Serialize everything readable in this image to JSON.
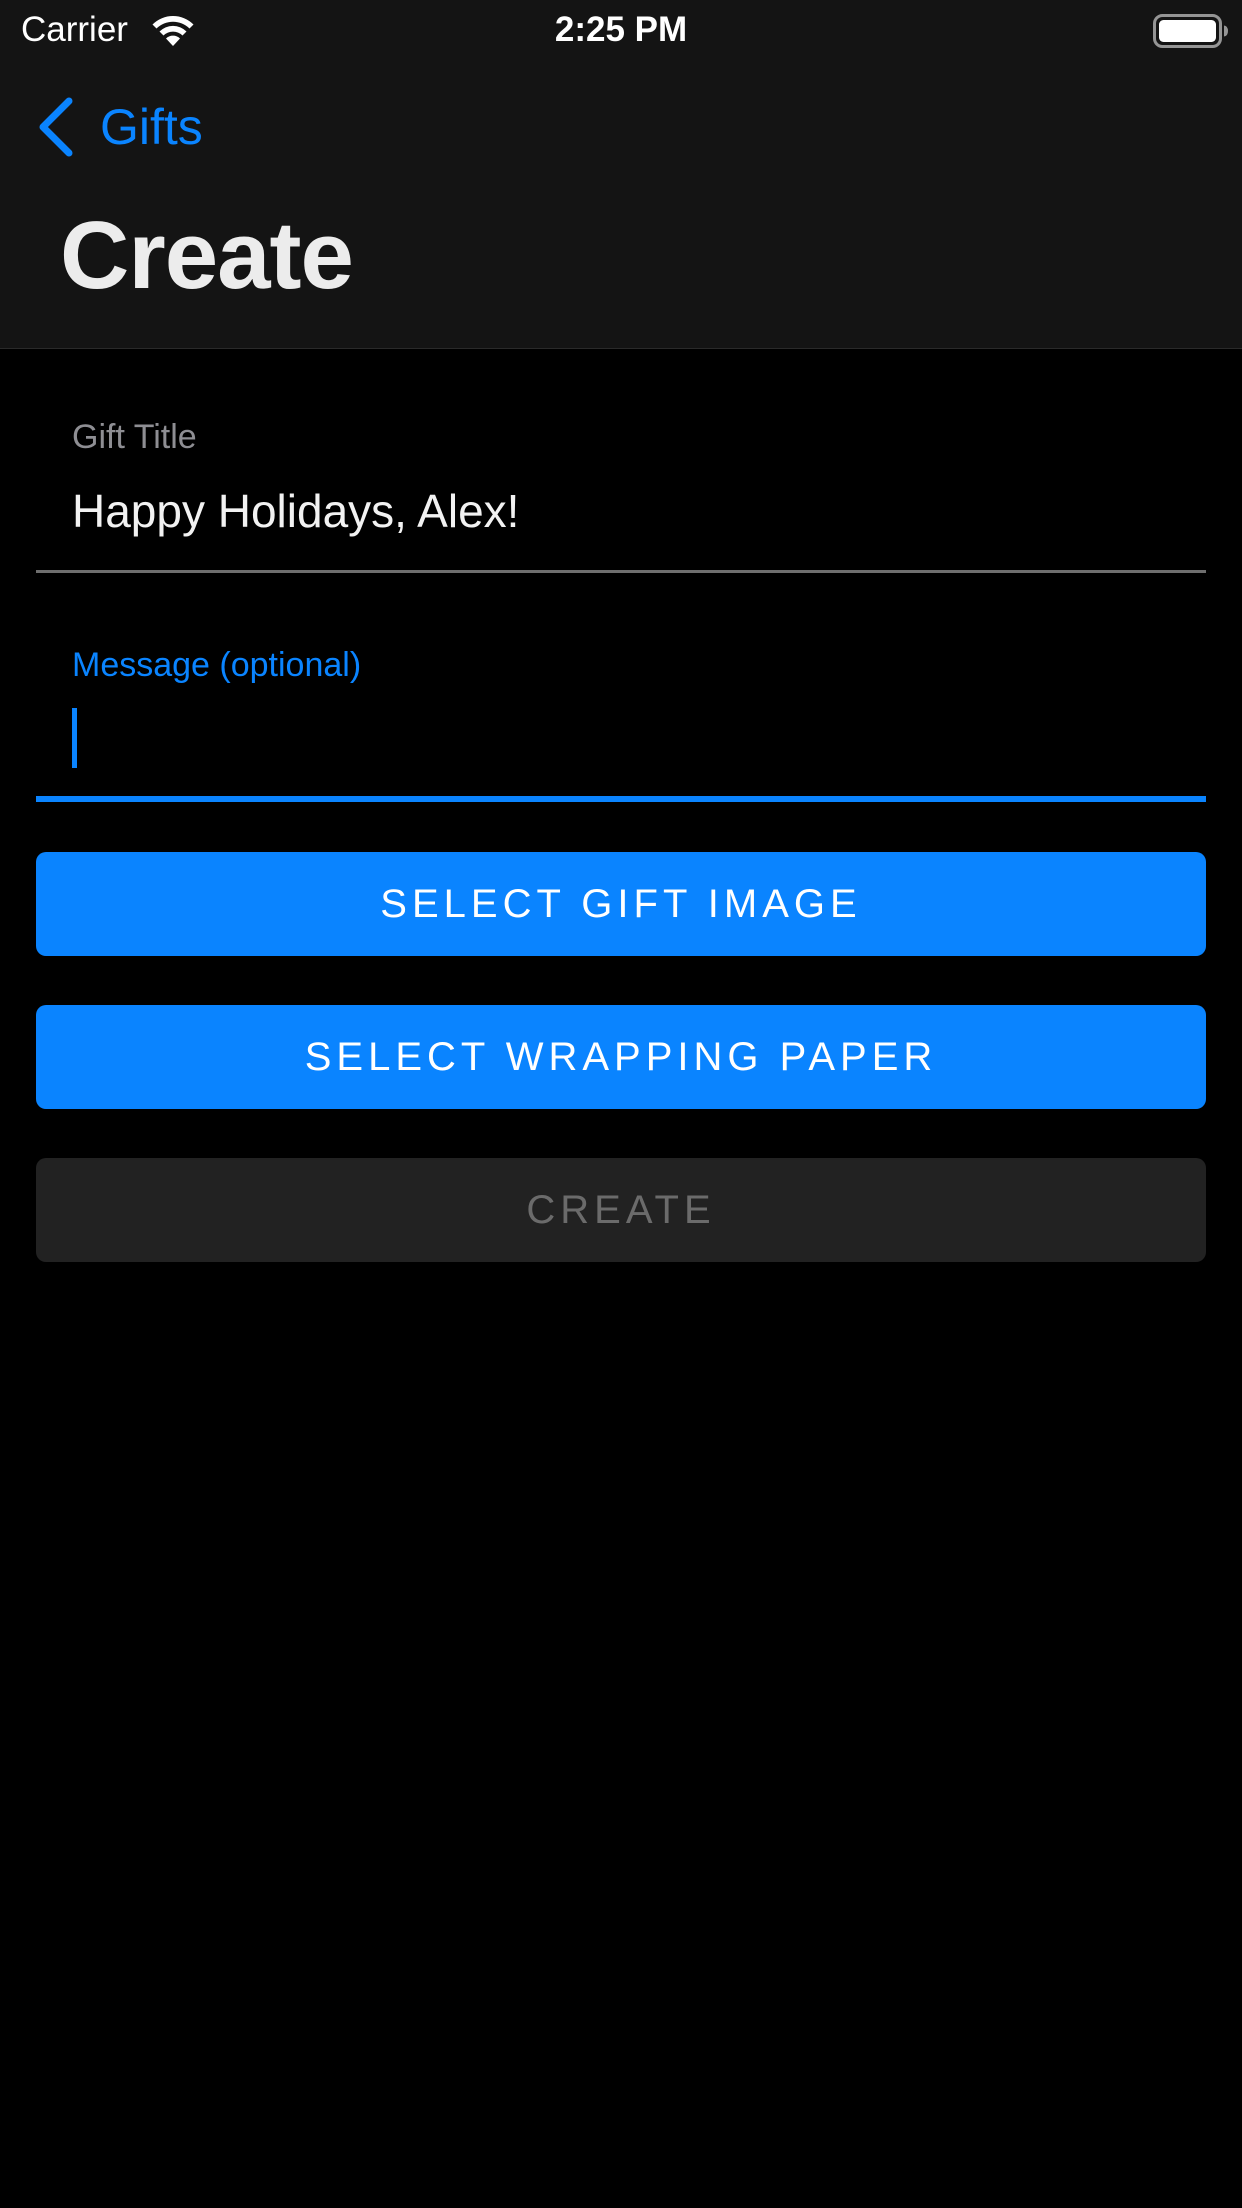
{
  "status_bar": {
    "carrier": "Carrier",
    "time": "2:25 PM",
    "icons": [
      "wifi-icon",
      "battery-icon"
    ]
  },
  "nav": {
    "back_label": "Gifts",
    "back_icon": "chevron-left-icon",
    "title": "Create"
  },
  "form": {
    "gift_title": {
      "label": "Gift Title",
      "value": "Happy Holidays, Alex!"
    },
    "message": {
      "label": "Message (optional)",
      "value": "",
      "focused": true
    }
  },
  "buttons": {
    "select_gift_image": "SELECT GIFT IMAGE",
    "select_wrapping_paper": "SELECT WRAPPING PAPER",
    "create": "CREATE",
    "create_enabled": false
  },
  "colors": {
    "accent": "#0a84ff",
    "background": "#000000",
    "header_background": "#141414",
    "disabled_button": "#222222",
    "disabled_text": "#6b6b6b"
  }
}
